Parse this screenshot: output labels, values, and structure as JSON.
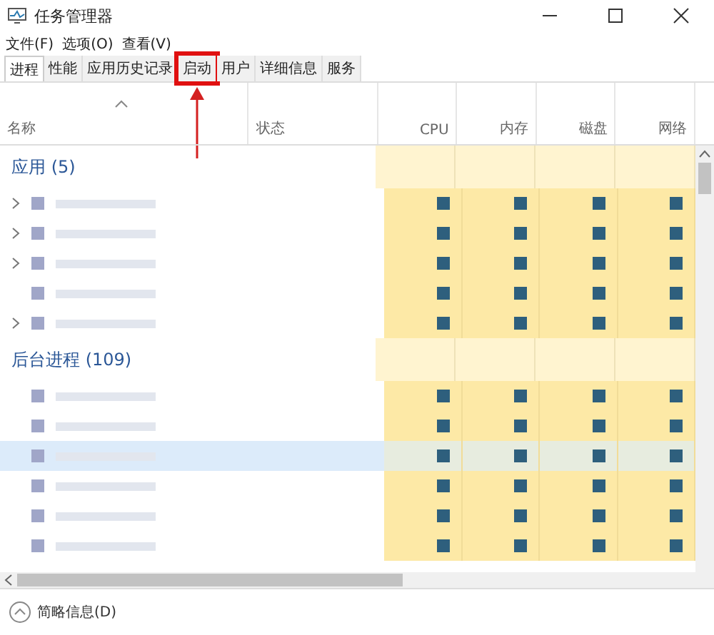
{
  "window": {
    "title": "任务管理器"
  },
  "menu": [
    "文件(F)",
    "选项(O)",
    "查看(V)"
  ],
  "tabs": [
    {
      "label": "进程",
      "selected": true,
      "highlighted": false
    },
    {
      "label": "性能",
      "selected": false,
      "highlighted": false
    },
    {
      "label": "应用历史记录",
      "selected": false,
      "highlighted": false
    },
    {
      "label": "启动",
      "selected": false,
      "highlighted": true
    },
    {
      "label": "用户",
      "selected": false,
      "highlighted": false
    },
    {
      "label": "详细信息",
      "selected": false,
      "highlighted": false
    },
    {
      "label": "服务",
      "selected": false,
      "highlighted": false
    }
  ],
  "columns": [
    {
      "label": "名称",
      "kind": "name"
    },
    {
      "label": "状态",
      "kind": "status"
    },
    {
      "label": "CPU",
      "kind": "metric"
    },
    {
      "label": "内存",
      "kind": "metric"
    },
    {
      "label": "磁盘",
      "kind": "metric"
    },
    {
      "label": "网络",
      "kind": "metric"
    }
  ],
  "groups": [
    {
      "title": "应用 (5)",
      "rows": [
        {
          "expandable": true,
          "selected": false
        },
        {
          "expandable": true,
          "selected": false
        },
        {
          "expandable": true,
          "selected": false
        },
        {
          "expandable": false,
          "selected": false
        },
        {
          "expandable": true,
          "selected": false
        }
      ]
    },
    {
      "title": "后台进程 (109)",
      "rows": [
        {
          "expandable": false,
          "selected": false
        },
        {
          "expandable": false,
          "selected": false
        },
        {
          "expandable": false,
          "selected": true
        },
        {
          "expandable": false,
          "selected": false
        },
        {
          "expandable": false,
          "selected": false
        },
        {
          "expandable": false,
          "selected": false
        }
      ]
    }
  ],
  "footer": {
    "label": "简略信息(D)"
  }
}
